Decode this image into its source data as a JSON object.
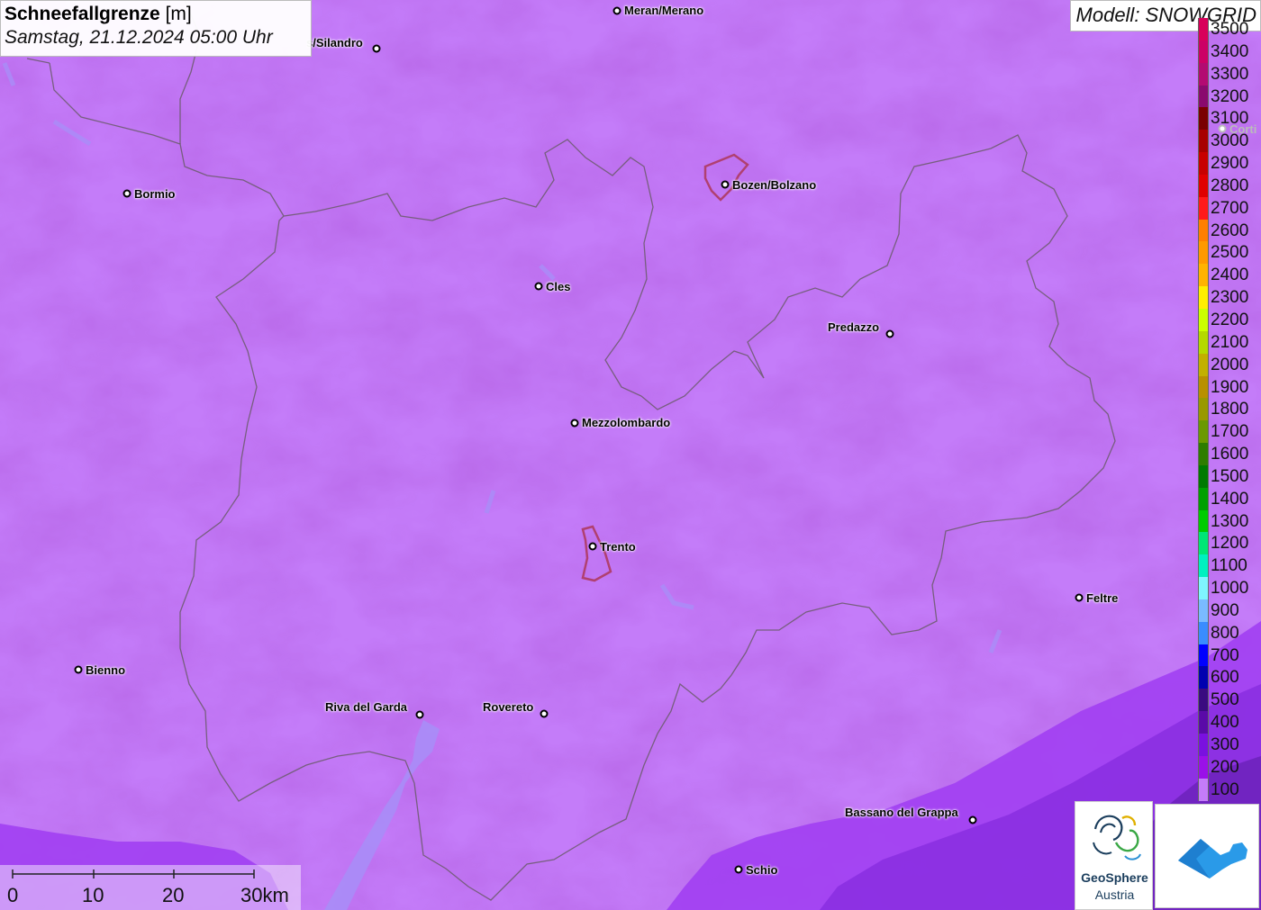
{
  "header": {
    "title": "Schneefallgrenze",
    "unit": "[m]",
    "datetime": "Samstag, 21.12.2024 05:00 Uhr"
  },
  "model_label": "Modell: SNOWGRID",
  "legend": [
    {
      "label": "3500",
      "color": "#d8005a"
    },
    {
      "label": "3400",
      "color": "#cc0066"
    },
    {
      "label": "3300",
      "color": "#b30a72"
    },
    {
      "label": "3200",
      "color": "#8a0a6e"
    },
    {
      "label": "3100",
      "color": "#7a0000"
    },
    {
      "label": "3000",
      "color": "#a80000"
    },
    {
      "label": "2900",
      "color": "#c80000"
    },
    {
      "label": "2800",
      "color": "#e00000"
    },
    {
      "label": "2700",
      "color": "#ff1a1a"
    },
    {
      "label": "2600",
      "color": "#ff7f00"
    },
    {
      "label": "2500",
      "color": "#ff9900"
    },
    {
      "label": "2400",
      "color": "#ffb300"
    },
    {
      "label": "2300",
      "color": "#ffee00"
    },
    {
      "label": "2200",
      "color": "#ccff00"
    },
    {
      "label": "2100",
      "color": "#b5d900"
    },
    {
      "label": "2000",
      "color": "#c2b000"
    },
    {
      "label": "1900",
      "color": "#b89000"
    },
    {
      "label": "1800",
      "color": "#999900"
    },
    {
      "label": "1700",
      "color": "#6b9900"
    },
    {
      "label": "1600",
      "color": "#2e7d00"
    },
    {
      "label": "1500",
      "color": "#007a00"
    },
    {
      "label": "1400",
      "color": "#00a000"
    },
    {
      "label": "1300",
      "color": "#00cc00"
    },
    {
      "label": "1200",
      "color": "#00e676"
    },
    {
      "label": "1100",
      "color": "#00f0c0"
    },
    {
      "label": "1000",
      "color": "#7ff5ff"
    },
    {
      "label": "900",
      "color": "#7abaff"
    },
    {
      "label": "800",
      "color": "#3a8cff"
    },
    {
      "label": "700",
      "color": "#0000ff"
    },
    {
      "label": "600",
      "color": "#0000b0"
    },
    {
      "label": "500",
      "color": "#3a0a80"
    },
    {
      "label": "400",
      "color": "#5a0aa8"
    },
    {
      "label": "300",
      "color": "#7a10e0"
    },
    {
      "label": "200",
      "color": "#9a10e8"
    },
    {
      "label": "100",
      "color": "#c47cf9"
    }
  ],
  "cities": [
    {
      "name": "Meran/Merano"
    },
    {
      "name": "s/Silandro"
    },
    {
      "name": "Bormio"
    },
    {
      "name": "Bozen/Bolzano"
    },
    {
      "name": "Cles"
    },
    {
      "name": "Predazzo"
    },
    {
      "name": "Mezzolombardo"
    },
    {
      "name": "Trento"
    },
    {
      "name": "Feltre"
    },
    {
      "name": "Bienno"
    },
    {
      "name": "Riva del Garda"
    },
    {
      "name": "Rovereto"
    },
    {
      "name": "Bassano del Grappa"
    },
    {
      "name": "Schio"
    },
    {
      "name": "Corti"
    }
  ],
  "scalebar": {
    "labels": [
      "0",
      "10",
      "20",
      "30km"
    ]
  },
  "logo": {
    "line1": "GeoSphere",
    "line2": "Austria"
  }
}
